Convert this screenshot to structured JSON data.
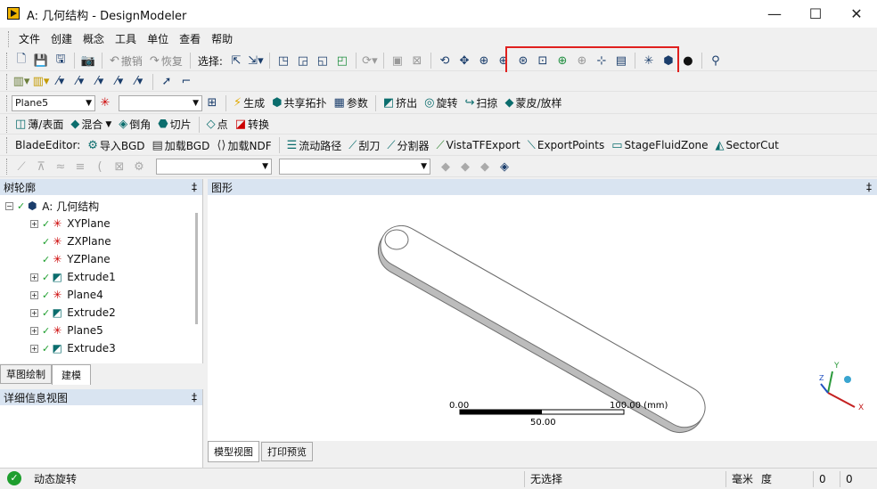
{
  "window": {
    "title": "A: 几何结构 - DesignModeler",
    "minimize": "—",
    "maximize": "☐",
    "close": "✕"
  },
  "menu": [
    "文件",
    "创建",
    "概念",
    "工具",
    "单位",
    "查看",
    "帮助"
  ],
  "toolbar1": {
    "undo": "撤销",
    "redo": "恢复",
    "select_label": "选择:"
  },
  "toolbar3": {
    "plane_value": "Plane5",
    "second_combo": "",
    "generate": "生成",
    "share_topo": "共享拓扑",
    "params": "参数",
    "extrude": "挤出",
    "revolve": "旋转",
    "sweep": "扫掠",
    "skin_loft": "蒙皮/放样"
  },
  "toolbar4": {
    "thin_surface": "薄/表面",
    "blend": "混合",
    "chamfer": "倒角",
    "slice": "切片",
    "point": "点",
    "convert": "转换"
  },
  "toolbar5": {
    "label": "BladeEditor:",
    "import_bgd": "导入BGD",
    "load_bgd": "加载BGD",
    "load_ndf": "加载NDF",
    "flow_path": "流动路径",
    "blade": "刮刀",
    "splitter": "分割器",
    "vista": "VistaTFExport",
    "export_points": "ExportPoints",
    "stage_fluid": "StageFluidZone",
    "sector_cut": "SectorCut"
  },
  "tree": {
    "title": "树轮廓",
    "pin": "‡",
    "root": "A: 几何结构",
    "items": [
      "XYPlane",
      "ZXPlane",
      "YZPlane",
      "Extrude1",
      "Plane4",
      "Extrude2",
      "Plane5",
      "Extrude3"
    ],
    "tabs": [
      "草图绘制",
      "建模"
    ]
  },
  "details": {
    "title": "详细信息视图",
    "pin": "‡"
  },
  "graphics": {
    "title": "图形",
    "pin": "‡",
    "scale_left": "0.00",
    "scale_right": "100.00 (mm)",
    "scale_mid": "50.00",
    "triad": {
      "x": "X",
      "y": "Y",
      "z": "Z"
    },
    "tabs": [
      "模型视图",
      "打印预览"
    ]
  },
  "status": {
    "mode": "动态旋转",
    "selection": "无选择",
    "unit_len": "毫米",
    "unit_angle": "度",
    "v1": "0",
    "v2": "0"
  },
  "colors": {
    "highlight": "#e0201e",
    "panel_head": "#d9e4f1",
    "check": "#1e9e2e"
  }
}
